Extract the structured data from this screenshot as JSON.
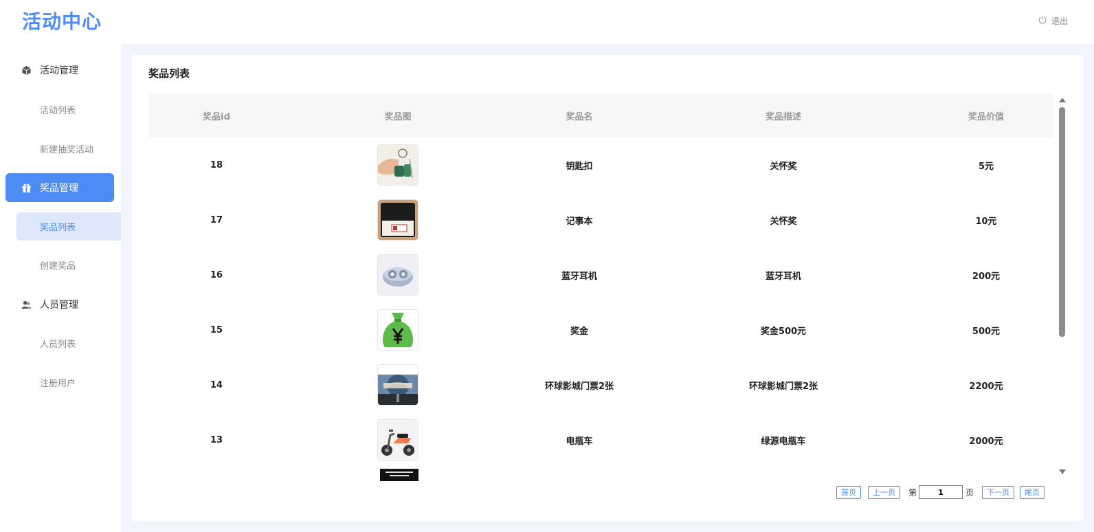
{
  "header": {
    "logo": "活动中心",
    "logout_label": "退出"
  },
  "sidebar": {
    "groups": [
      {
        "label": "活动管理",
        "icon": "cube-icon",
        "items": [
          {
            "label": "活动列表"
          },
          {
            "label": "新建抽奖活动"
          }
        ]
      },
      {
        "label": "奖品管理",
        "icon": "gift-icon",
        "active": true,
        "items": [
          {
            "label": "奖品列表",
            "active": true
          },
          {
            "label": "创建奖品"
          }
        ]
      },
      {
        "label": "人员管理",
        "icon": "users-icon",
        "items": [
          {
            "label": "人员列表"
          },
          {
            "label": "注册用户"
          }
        ]
      }
    ]
  },
  "main": {
    "title": "奖品列表",
    "table": {
      "columns": [
        "奖品id",
        "奖品图",
        "奖品名",
        "奖品描述",
        "奖品价值"
      ],
      "rows": [
        {
          "id": "18",
          "image": "keychain-image",
          "name": "钥匙扣",
          "desc": "关怀奖",
          "value": "5元"
        },
        {
          "id": "17",
          "image": "notebook-image",
          "name": "记事本",
          "desc": "关怀奖",
          "value": "10元"
        },
        {
          "id": "16",
          "image": "earbuds-image",
          "name": "蓝牙耳机",
          "desc": "蓝牙耳机",
          "value": "200元"
        },
        {
          "id": "15",
          "image": "money-bag-image",
          "name": "奖金",
          "desc": "奖金500元",
          "value": "500元"
        },
        {
          "id": "14",
          "image": "universal-globe-image",
          "name": "环球影城门票2张",
          "desc": "环球影城门票2张",
          "value": "2200元"
        },
        {
          "id": "13",
          "image": "scooter-image",
          "name": "电瓶车",
          "desc": "绿源电瓶车",
          "value": "2000元"
        }
      ]
    }
  },
  "pager": {
    "first": "首页",
    "prev": "上一页",
    "page_prefix": "第",
    "page_value": "1",
    "page_suffix": "页",
    "next": "下一页",
    "last": "尾页"
  },
  "colors": {
    "accent": "#4d8cf5",
    "active_item_bg": "#dde8fd",
    "page_bg": "#f2f5fb"
  }
}
